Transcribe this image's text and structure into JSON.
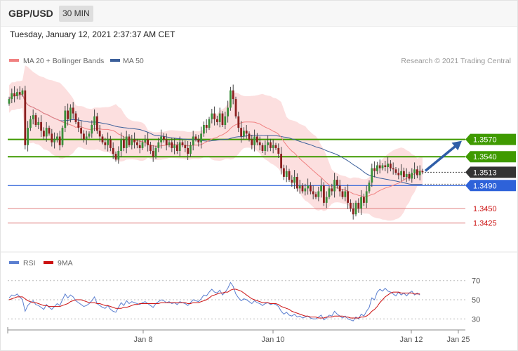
{
  "header": {
    "symbol": "GBP/USD",
    "timeframe": "30 MIN",
    "datetime": "Tuesday, January 12, 2021 2:37:37 AM CET"
  },
  "chart_data": [
    {
      "type": "candlestick",
      "legend": [
        {
          "name": "MA 20 + Bollinger Bands",
          "color": "#f08080"
        },
        {
          "name": "MA 50",
          "color": "#3b5f9a"
        }
      ],
      "credit": "Research © 2021 Trading Central",
      "ylim": [
        1.341,
        1.369
      ],
      "y_labels": [
        {
          "value": 1.357,
          "text": "1.3570",
          "kind": "resistance"
        },
        {
          "value": 1.354,
          "text": "1.3540",
          "kind": "resistance"
        },
        {
          "value": 1.3513,
          "text": "1.3513",
          "kind": "last"
        },
        {
          "value": 1.349,
          "text": "1.3490",
          "kind": "pivot"
        },
        {
          "value": 1.345,
          "text": "1.3450",
          "kind": "support"
        },
        {
          "value": 1.3425,
          "text": "1.3425",
          "kind": "support"
        }
      ],
      "last_price": 1.3513,
      "forecast_target": 1.357,
      "close": [
        1.364,
        1.365,
        1.3645,
        1.3652,
        1.3648,
        1.3655,
        1.356,
        1.359,
        1.3605,
        1.3612,
        1.3595,
        1.36,
        1.3585,
        1.3575,
        1.359,
        1.358,
        1.3565,
        1.357,
        1.3575,
        1.356,
        1.359,
        1.362,
        1.3605,
        1.3625,
        1.3615,
        1.36,
        1.359,
        1.358,
        1.357,
        1.3575,
        1.358,
        1.3595,
        1.361,
        1.3585,
        1.3575,
        1.3565,
        1.356,
        1.357,
        1.3555,
        1.3545,
        1.3535,
        1.355,
        1.357,
        1.3555,
        1.3575,
        1.356,
        1.357,
        1.3565,
        1.356,
        1.3555,
        1.3565,
        1.357,
        1.356,
        1.355,
        1.354,
        1.3555,
        1.3565,
        1.3575,
        1.357,
        1.356,
        1.3565,
        1.3555,
        1.356,
        1.355,
        1.3565,
        1.356,
        1.3555,
        1.3545,
        1.356,
        1.3575,
        1.357,
        1.3565,
        1.358,
        1.3595,
        1.359,
        1.3605,
        1.3615,
        1.3605,
        1.36,
        1.3615,
        1.3595,
        1.361,
        1.3625,
        1.3655,
        1.364,
        1.361,
        1.359,
        1.3575,
        1.3585,
        1.358,
        1.357,
        1.356,
        1.3575,
        1.3565,
        1.356,
        1.355,
        1.356,
        1.3565,
        1.3555,
        1.356,
        1.3555,
        1.3545,
        1.352,
        1.3505,
        1.3515,
        1.35,
        1.3495,
        1.3505,
        1.3485,
        1.349,
        1.348,
        1.3485,
        1.349,
        1.348,
        1.3475,
        1.347,
        1.348,
        1.349,
        1.346,
        1.347,
        1.3485,
        1.348,
        1.35,
        1.349,
        1.348,
        1.347,
        1.348,
        1.346,
        1.345,
        1.344,
        1.346,
        1.345,
        1.347,
        1.346,
        1.348,
        1.3495,
        1.352,
        1.3515,
        1.3525,
        1.352,
        1.3525,
        1.3522,
        1.3528,
        1.352,
        1.3518,
        1.3512,
        1.3508,
        1.3515,
        1.3505,
        1.351,
        1.3502,
        1.3512,
        1.3518,
        1.3508,
        1.3515,
        1.3513
      ],
      "rsi": {
        "legend": [
          {
            "name": "RSI",
            "color": "#5b7fd0"
          },
          {
            "name": "9MA",
            "color": "#cc1111"
          }
        ],
        "ylim": [
          20,
          80
        ],
        "ticks": [
          70,
          50,
          30
        ],
        "rsi_values": [
          52,
          55,
          54,
          56,
          53,
          50,
          38,
          44,
          47,
          49,
          45,
          44,
          42,
          40,
          45,
          42,
          40,
          43,
          46,
          44,
          50,
          56,
          52,
          55,
          53,
          49,
          47,
          45,
          43,
          44,
          46,
          49,
          53,
          46,
          44,
          42,
          41,
          44,
          40,
          38,
          37,
          42,
          47,
          44,
          49,
          46,
          48,
          47,
          46,
          45,
          47,
          48,
          46,
          44,
          42,
          46,
          48,
          50,
          49,
          47,
          48,
          46,
          47,
          45,
          48,
          47,
          46,
          44,
          47,
          50,
          49,
          48,
          51,
          55,
          54,
          58,
          61,
          58,
          57,
          60,
          55,
          58,
          62,
          68,
          64,
          56,
          52,
          49,
          51,
          50,
          48,
          46,
          49,
          47,
          46,
          44,
          46,
          47,
          45,
          46,
          45,
          43,
          38,
          35,
          37,
          34,
          33,
          35,
          32,
          33,
          31,
          32,
          33,
          31,
          30,
          30,
          32,
          34,
          29,
          31,
          34,
          33,
          38,
          35,
          33,
          31,
          33,
          30,
          29,
          28,
          32,
          30,
          35,
          33,
          38,
          42,
          52,
          50,
          58,
          61,
          59,
          62,
          59,
          58,
          56,
          54,
          58,
          55,
          57,
          54,
          57,
          59,
          55,
          57,
          55
        ],
        "ma9_values": [
          50,
          51,
          52,
          53,
          53,
          53,
          51,
          49,
          48,
          47,
          47,
          46,
          45,
          44,
          44,
          43,
          43,
          43,
          43,
          43,
          44,
          45,
          46,
          48,
          49,
          50,
          50,
          50,
          49,
          48,
          47,
          47,
          47,
          46,
          46,
          45,
          44,
          44,
          43,
          42,
          41,
          41,
          41,
          42,
          42,
          43,
          44,
          45,
          45,
          46,
          46,
          46,
          46,
          46,
          46,
          46,
          46,
          47,
          47,
          47,
          47,
          47,
          47,
          47,
          47,
          47,
          47,
          46,
          46,
          47,
          47,
          47,
          48,
          49,
          50,
          52,
          54,
          55,
          56,
          57,
          57,
          58,
          58,
          60,
          61,
          61,
          60,
          59,
          57,
          55,
          53,
          51,
          50,
          49,
          48,
          47,
          47,
          47,
          46,
          46,
          46,
          45,
          43,
          42,
          41,
          40,
          38,
          37,
          36,
          35,
          34,
          33,
          33,
          32,
          32,
          32,
          31,
          31,
          31,
          32,
          32,
          32,
          33,
          33,
          33,
          33,
          32,
          32,
          31,
          31,
          31,
          31,
          32,
          32,
          33,
          35,
          38,
          40,
          43,
          47,
          50,
          53,
          55,
          57,
          58,
          58,
          58,
          57,
          57,
          57,
          57,
          57,
          56,
          56,
          56
        ]
      },
      "x_labels": [
        "Jan 8",
        "Jan 10",
        "Jan 12",
        "Jan 25"
      ]
    }
  ]
}
